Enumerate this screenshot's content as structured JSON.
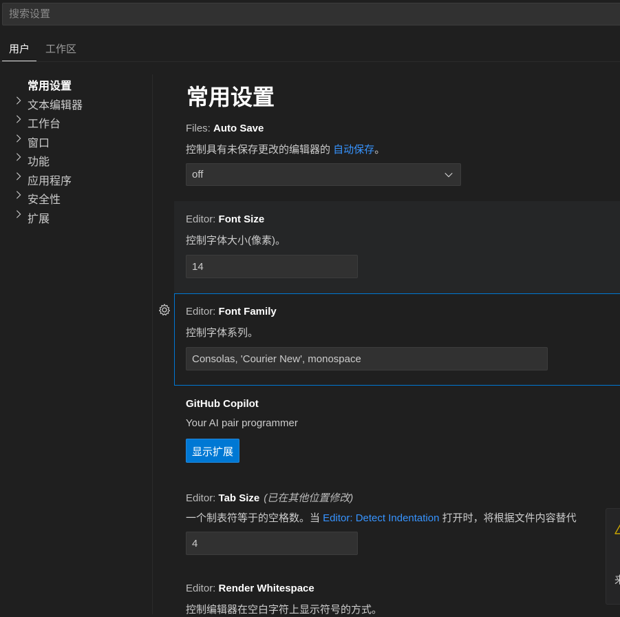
{
  "search": {
    "placeholder": "搜索设置"
  },
  "scope_tabs": {
    "user": "用户",
    "workspace": "工作区"
  },
  "toc": {
    "items": [
      {
        "label": "常用设置",
        "has_chevron": false,
        "active": true
      },
      {
        "label": "文本编辑器",
        "has_chevron": true
      },
      {
        "label": "工作台",
        "has_chevron": true
      },
      {
        "label": "窗口",
        "has_chevron": true
      },
      {
        "label": "功能",
        "has_chevron": true
      },
      {
        "label": "应用程序",
        "has_chevron": true
      },
      {
        "label": "安全性",
        "has_chevron": true
      },
      {
        "label": "扩展",
        "has_chevron": true
      }
    ]
  },
  "main": {
    "title": "常用设置",
    "auto_save": {
      "category": "Files: ",
      "name": "Auto Save",
      "desc_prefix": "控制具有未保存更改的编辑器的 ",
      "desc_link": "自动保存",
      "desc_suffix": "。",
      "value": "off"
    },
    "font_size": {
      "category": "Editor: ",
      "name": "Font Size",
      "desc": "控制字体大小(像素)。",
      "value": "14"
    },
    "font_family": {
      "category": "Editor: ",
      "name": "Font Family",
      "desc": "控制字体系列。",
      "value": "Consolas, 'Courier New', monospace"
    },
    "copilot": {
      "name": "GitHub Copilot",
      "desc": "Your AI pair programmer",
      "button": "显示扩展"
    },
    "tab_size": {
      "category": "Editor: ",
      "name": "Tab Size",
      "modified": "(已在其他位置修改)",
      "desc_prefix": "一个制表符等于的空格数。当 ",
      "desc_link": "Editor: Detect Indentation",
      "desc_suffix": " 打开时，将根据文件内容替代",
      "value": "4"
    },
    "render_whitespace": {
      "category": "Editor: ",
      "name": "Render Whitespace",
      "desc": "控制编辑器在空白字符上显示符号的方式。"
    }
  },
  "notification": {
    "icon": "warning-icon",
    "text": "来"
  },
  "colors": {
    "accent": "#0078d4",
    "link": "#3794ff",
    "background": "#1f1f1f"
  }
}
